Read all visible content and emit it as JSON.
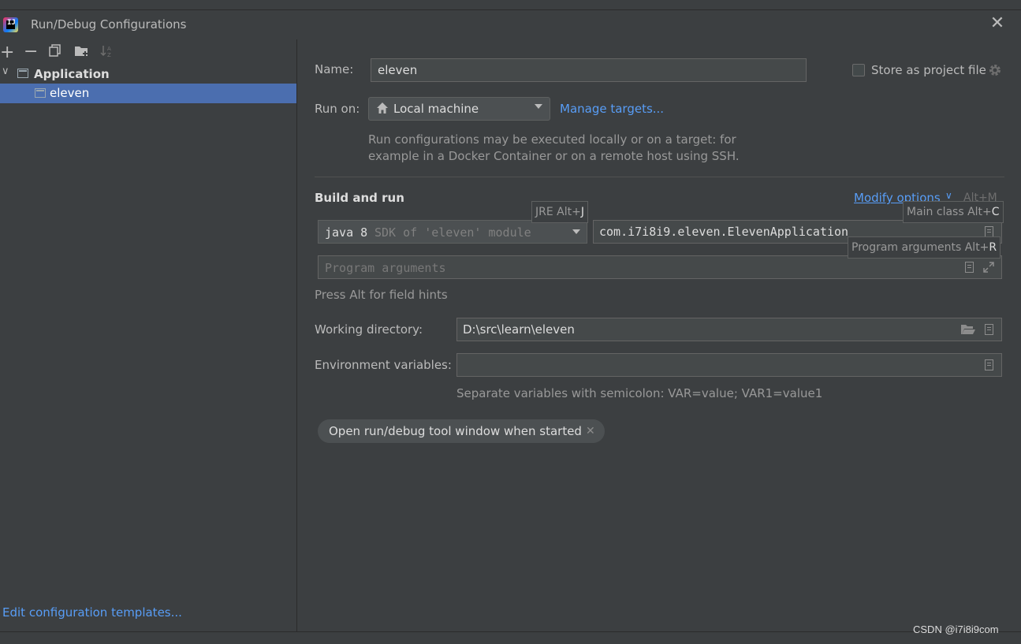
{
  "window": {
    "title": "Run/Debug Configurations"
  },
  "sidebar": {
    "tree_group": "Application",
    "tree_item": "eleven",
    "edit_templates": "Edit configuration templates..."
  },
  "form": {
    "name_label": "Name:",
    "name_value": "eleven",
    "store_label": "Store as project file",
    "run_on_label": "Run on:",
    "run_on_value": "Local machine",
    "manage_targets": "Manage targets...",
    "run_on_desc_1": "Run configurations may be executed locally or on a target: for",
    "run_on_desc_2": "example in a Docker Container or on a remote host using SSH.",
    "build_heading": "Build and run",
    "modify_options": "Modify options",
    "modify_shortcut": "Alt+M",
    "jre_version": "java 8",
    "jre_desc": "SDK of 'eleven' module",
    "main_class": "com.i7i8i9.eleven.ElevenApplication",
    "program_args_placeholder": "Program arguments",
    "field_hints": "Press Alt for field hints",
    "working_dir_label": "Working directory:",
    "working_dir_value": "D:\\src\\learn\\eleven",
    "env_label": "Environment variables:",
    "env_value": "",
    "env_hint": "Separate variables with semicolon: VAR=value; VAR1=value1",
    "chip_label": "Open run/debug tool window when started"
  },
  "tooltips": {
    "jre_text": "JRE Alt+",
    "jre_key": "J",
    "main_class_text": "Main class Alt+",
    "main_class_key": "C",
    "program_args_text": "Program arguments Alt+",
    "program_args_key": "R"
  },
  "watermark": "CSDN @i7i8i9com",
  "icons": {
    "toolbar": [
      "plus-icon",
      "minus-icon",
      "copy-icon",
      "folder-add-icon",
      "sort-icon"
    ],
    "misc": [
      "home-icon",
      "gear-icon",
      "folder-open-icon",
      "expand-icon",
      "chevron-down-icon",
      "close-icon"
    ]
  }
}
